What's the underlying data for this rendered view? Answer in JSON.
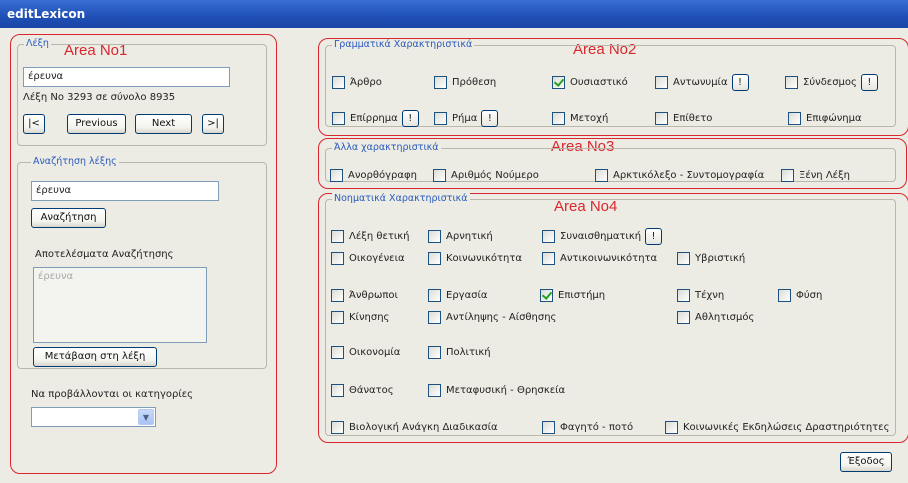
{
  "window": {
    "title": "editLexicon"
  },
  "annotations": {
    "area1": "Area No1",
    "area2": "Area No2",
    "area3": "Area No3",
    "area4": "Area No4"
  },
  "word_panel": {
    "group_title": "Λέξη",
    "word_value": "έρευνα",
    "position_text": "Λέξη Νο 3293 σε σύνολο 8935",
    "first_label": "|<",
    "previous_label": "Previous",
    "next_label": "Next",
    "last_label": ">|"
  },
  "search_panel": {
    "group_title": "Αναζήτηση λέξης",
    "search_value": "έρευνα",
    "search_button": "Αναζήτηση",
    "results_label": "Αποτελέσματα Αναζήτησης",
    "results": [
      "έρευνα"
    ],
    "goto_button": "Μετάβαση στη λέξη"
  },
  "categories_label": "Να προβάλλονται οι κατηγορίες",
  "categories_select_value": "",
  "grammar": {
    "group_title": "Γραμματικά Χαρακτηριστικά",
    "items": [
      {
        "label": "Άρθρο",
        "checked": false
      },
      {
        "label": "Πρόθεση",
        "checked": false
      },
      {
        "label": "Ουσιαστικό",
        "checked": true
      },
      {
        "label": "Αντωνυμία",
        "checked": false,
        "info": "!"
      },
      {
        "label": "Σύνδεσμος",
        "checked": false,
        "info": "!"
      },
      {
        "label": "Επίρρημα",
        "checked": false,
        "info": "!"
      },
      {
        "label": "Ρήμα",
        "checked": false,
        "info": "!"
      },
      {
        "label": "Μετοχή",
        "checked": false
      },
      {
        "label": "Επίθετο",
        "checked": false
      },
      {
        "label": "Επιφώνημα",
        "checked": false
      }
    ]
  },
  "other": {
    "group_title": "Άλλα χαρακτηριστικά",
    "items": [
      {
        "label": "Ανορθόγραφη",
        "checked": false
      },
      {
        "label": "Αριθμός Νούμερο",
        "checked": false
      },
      {
        "label": "Αρκτικόλεξο - Συντομογραφία",
        "checked": false
      },
      {
        "label": "Ξένη Λέξη",
        "checked": false
      }
    ]
  },
  "semantic": {
    "group_title": "Νοηματικά Χαρακτηριστικά",
    "items": [
      {
        "label": "Λέξη θετική",
        "checked": false
      },
      {
        "label": "Αρνητική",
        "checked": false
      },
      {
        "label": "Συναισθηματική",
        "checked": false,
        "info": "!"
      },
      {
        "label": "Οικογένεια",
        "checked": false
      },
      {
        "label": "Κοινωνικότητα",
        "checked": false
      },
      {
        "label": "Αντικοινωνικότητα",
        "checked": false
      },
      {
        "label": "Υβριστική",
        "checked": false
      },
      {
        "label": "Άνθρωποι",
        "checked": false
      },
      {
        "label": "Εργασία",
        "checked": false
      },
      {
        "label": "Επιστήμη",
        "checked": true
      },
      {
        "label": "Τέχνη",
        "checked": false
      },
      {
        "label": "Φύση",
        "checked": false
      },
      {
        "label": "Κίνησης",
        "checked": false
      },
      {
        "label": "Αντίληψης - Αίσθησης",
        "checked": false
      },
      {
        "label": "Αθλητισμός",
        "checked": false
      },
      {
        "label": "Οικονομία",
        "checked": false
      },
      {
        "label": "Πολιτική",
        "checked": false
      },
      {
        "label": "Θάνατος",
        "checked": false
      },
      {
        "label": "Μεταφυσική - Θρησκεία",
        "checked": false
      },
      {
        "label": "Βιολογική Ανάγκη Διαδικασία",
        "checked": false
      },
      {
        "label": "Φαγητό - ποτό",
        "checked": false
      },
      {
        "label": "Κοινωνικές Εκδηλώσεις Δραστηριότητες",
        "checked": false
      }
    ]
  },
  "exit_button": "Έξοδος",
  "colors": {
    "title_bar": "#2456c0",
    "annotation": "#d9272e",
    "group_title": "#2a5bbd",
    "window_bg": "#ecebe4"
  }
}
